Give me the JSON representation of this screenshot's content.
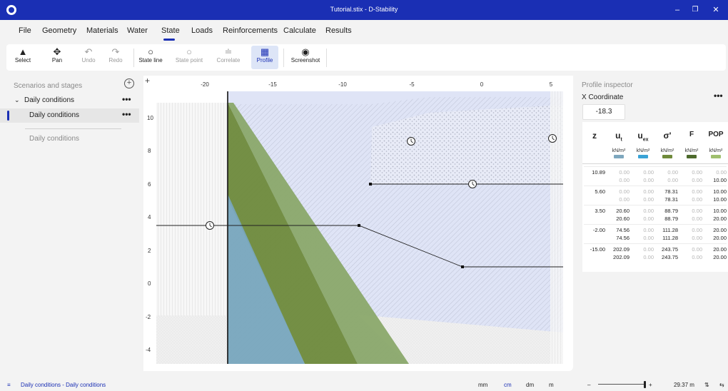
{
  "window": {
    "title": "Tutorial.stix - D-Stability",
    "minimize": "–",
    "maximize": "❐",
    "close": "✕"
  },
  "menu": [
    "File",
    "Geometry",
    "Materials",
    "Water",
    "State",
    "Loads",
    "Reinforcements",
    "Calculate",
    "Results"
  ],
  "active_menu": "State",
  "toolbar": {
    "select": "Select",
    "pan": "Pan",
    "undo": "Undo",
    "redo": "Redo",
    "state_line": "State line",
    "state_point": "State point",
    "correlate": "Correlate",
    "profile": "Profile",
    "screenshot": "Screenshot"
  },
  "left": {
    "header": "Scenarios and stages",
    "scenario": "Daily conditions",
    "stage": "Daily conditions",
    "stage_ghost": "Daily conditions",
    "dots": "•••"
  },
  "canvas": {
    "x_ticks": [
      "-20",
      "-15",
      "-10",
      "-5",
      "0",
      "5"
    ],
    "y_ticks": [
      "10",
      "8",
      "6",
      "4",
      "2",
      "0",
      "-2",
      "-4"
    ]
  },
  "inspector": {
    "title": "Profile inspector",
    "x_label": "X Coordinate",
    "x_value": "-18.3",
    "dots": "•••",
    "columns": [
      {
        "name": "z",
        "sub": "",
        "unit": "",
        "color": ""
      },
      {
        "name": "u",
        "sub": "t",
        "unit": "kN/m²",
        "color": "#7ea7be"
      },
      {
        "name": "u",
        "sub": "ex",
        "unit": "kN/m²",
        "color": "#3aa3d6"
      },
      {
        "name": "σ'",
        "sub": "",
        "unit": "kN/m²",
        "color": "#6f8a3a"
      },
      {
        "name": "F",
        "sub": "",
        "unit": "kN/m²",
        "color": "#4d6a2c"
      },
      {
        "name": "POP",
        "sub": "",
        "unit": "kN/m²",
        "color": "#9fbf6e"
      }
    ],
    "rows": [
      {
        "z": "10.89",
        "a": [
          "0.00",
          "0.00",
          "0.00",
          "0.00",
          "0.00"
        ],
        "b": [
          "0.00",
          "0.00",
          "0.00",
          "0.00",
          "10.00"
        ]
      },
      {
        "z": "5.60",
        "a": [
          "0.00",
          "0.00",
          "78.31",
          "0.00",
          "10.00"
        ],
        "b": [
          "0.00",
          "0.00",
          "78.31",
          "0.00",
          "10.00"
        ]
      },
      {
        "z": "3.50",
        "a": [
          "20.60",
          "0.00",
          "88.79",
          "0.00",
          "10.00"
        ],
        "b": [
          "20.60",
          "0.00",
          "88.79",
          "0.00",
          "20.00"
        ]
      },
      {
        "z": "-2.00",
        "a": [
          "74.56",
          "0.00",
          "111.28",
          "0.00",
          "20.00"
        ],
        "b": [
          "74.56",
          "0.00",
          "111.28",
          "0.00",
          "20.00"
        ]
      },
      {
        "z": "-15.00",
        "a": [
          "202.09",
          "0.00",
          "243.75",
          "0.00",
          "20.00"
        ],
        "b": [
          "202.09",
          "0.00",
          "243.75",
          "0.00",
          "20.00"
        ]
      }
    ]
  },
  "status": {
    "breadcrumb": "Daily conditions - Daily conditions",
    "units": [
      "mm",
      "cm",
      "dm",
      "m"
    ],
    "active_unit": "cm",
    "zoom_minus": "–",
    "zoom_plus": "+",
    "zoom": "29.37 m",
    "icons": [
      "sort-icon",
      "swap-icon"
    ]
  }
}
